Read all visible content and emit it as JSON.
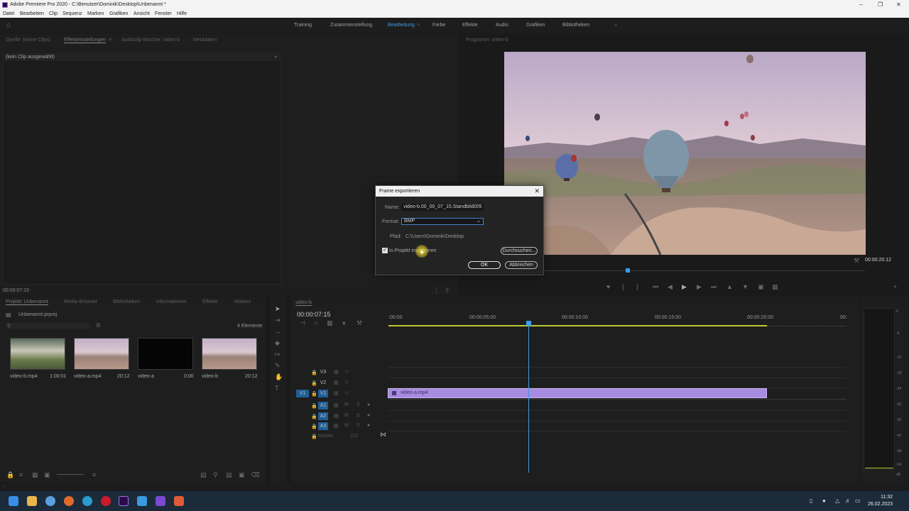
{
  "window": {
    "title": "Adobe Premiere Pro 2020 - C:\\Benutzer\\Dominik\\Desktop\\Unbenannt *"
  },
  "menu": [
    "Datei",
    "Bearbeiten",
    "Clip",
    "Sequenz",
    "Marken",
    "Grafiken",
    "Ansicht",
    "Fenster",
    "Hilfe"
  ],
  "workspaces": {
    "items": [
      "Training",
      "Zusammenstellung",
      "Bearbeitung",
      "Farbe",
      "Effekte",
      "Audio",
      "Grafiken",
      "Bibliotheken"
    ],
    "active": "Bearbeitung"
  },
  "source_panel": {
    "tabs": [
      "Quelle: (keine Clips)",
      "Effekteinstellungen",
      "Audioclip-Mischer: video-b",
      "Metadaten"
    ],
    "no_clip": "(kein Clip ausgewählt)",
    "timecode": "00:00:07:15"
  },
  "program_monitor": {
    "tab": "Programm: video-b",
    "timecode": "00:00:20:12"
  },
  "dialog": {
    "title": "Frame exportieren",
    "name_label": "Name:",
    "name_value": "video-b.00_00_07_15.Standbild005",
    "format_label": "Format:",
    "format_value": "BMP",
    "path_label": "Pfad:",
    "path_value": "C:\\Users\\Dominik\\Desktop",
    "import_label": "In Projekt importieren",
    "browse": "Durchsuchen...",
    "ok": "OK",
    "cancel": "Abbrechen"
  },
  "project_panel": {
    "tabs": [
      "Projekt: Unbenannt",
      "Media-Browser",
      "Bibliotheken",
      "Informationen",
      "Effekte",
      "Marken"
    ],
    "file": "Unbenannt.prproj",
    "count": "4 Elemente",
    "items": [
      {
        "name": "video-b.mp4",
        "duration": "1:00:01"
      },
      {
        "name": "video-a.mp4",
        "duration": "20:12"
      },
      {
        "name": "video-a",
        "duration": "0:00"
      },
      {
        "name": "video-b",
        "duration": "20:12"
      }
    ]
  },
  "timeline": {
    "tab": "video-b",
    "timecode": "00:00:07:15",
    "ruler": [
      ":00:00",
      "00:00:05:00",
      "00:00:10:00",
      "00:00:15:00",
      "00:00:20:00",
      "00:"
    ],
    "video_tracks": [
      "V3",
      "V2",
      "V1"
    ],
    "audio_tracks": [
      "A1",
      "A2",
      "A3"
    ],
    "source_patch_v": "V1",
    "master": "Master",
    "master_value": "0,0",
    "clip": "video-a.mp4"
  },
  "meter_labels": [
    "0",
    "-6",
    "-12",
    "-18",
    "-24",
    "-30",
    "-36",
    "-42",
    "-48",
    "-54",
    "dB"
  ],
  "taskbar": {
    "time": "11:32",
    "date": "26.02.2023"
  },
  "colors": {
    "accent": "#3d9be9",
    "clip": "#a78be0",
    "playhead": "#3d9be9"
  }
}
